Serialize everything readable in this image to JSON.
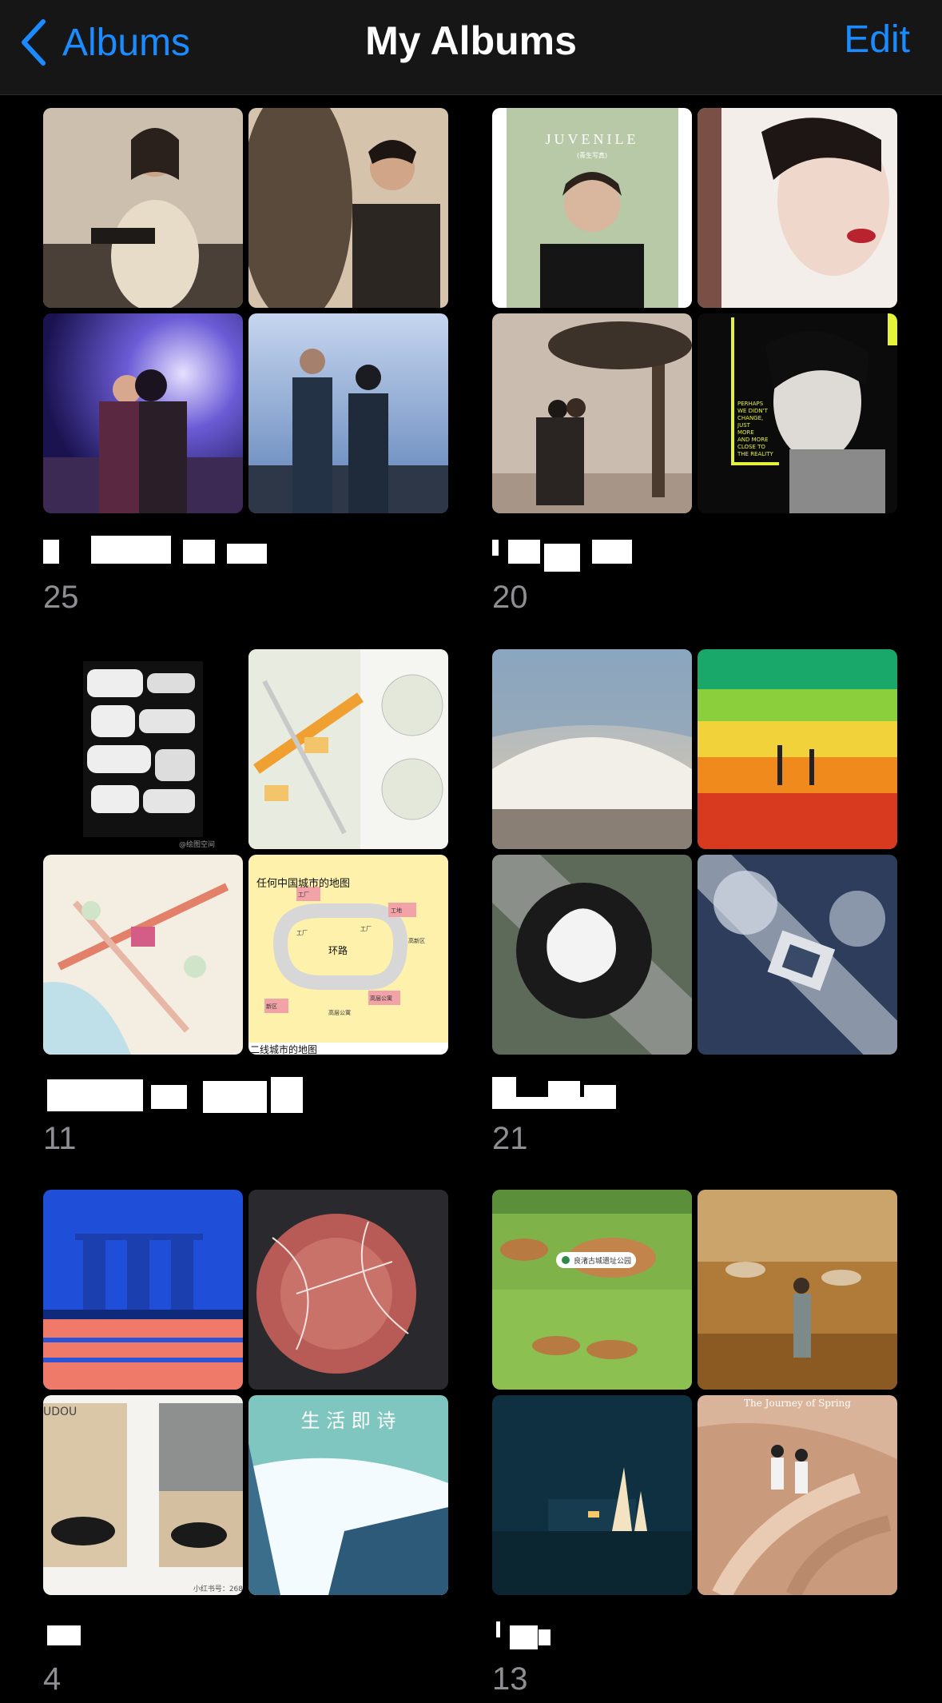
{
  "nav": {
    "back_label": "Albums",
    "title": "My Albums",
    "edit_label": "Edit"
  },
  "albums": [
    {
      "name": "",
      "count": "25"
    },
    {
      "name": "",
      "count": "20"
    },
    {
      "name": "",
      "count": "11"
    },
    {
      "name": "",
      "count": "21"
    },
    {
      "name": "",
      "count": "4"
    },
    {
      "name": "",
      "count": "13"
    }
  ],
  "photo_text": {
    "juvenile": "JUVENILE",
    "juvenile_sub": "(青生写真)",
    "perhaps": [
      "PERHAPS",
      "WE DIDN'T",
      "CHANGE,",
      "JUST",
      "MORE",
      "AND MORE",
      "CLOSE TO",
      "THE REALITY"
    ],
    "weibo_mark": "@绘图空间",
    "map_title": "任何中国城市的地图",
    "map_ring": "环路",
    "map_caption": "二线城市的地图",
    "map_labels": [
      "工厂",
      "高层公寓",
      "工地",
      "新区",
      "高新区",
      "工厂",
      "高层公寓",
      "工厂"
    ],
    "life_poem": "生 活 即 诗",
    "deer_location": "良渚古城遗址公园",
    "dunes_word": "UDOU",
    "xhs_mark": "小红书号：268",
    "spring_title": "The Journey of Spring"
  },
  "colors": {
    "accent": "#1a8cff",
    "nav_bg": "#161616",
    "count": "#8e8e93"
  }
}
